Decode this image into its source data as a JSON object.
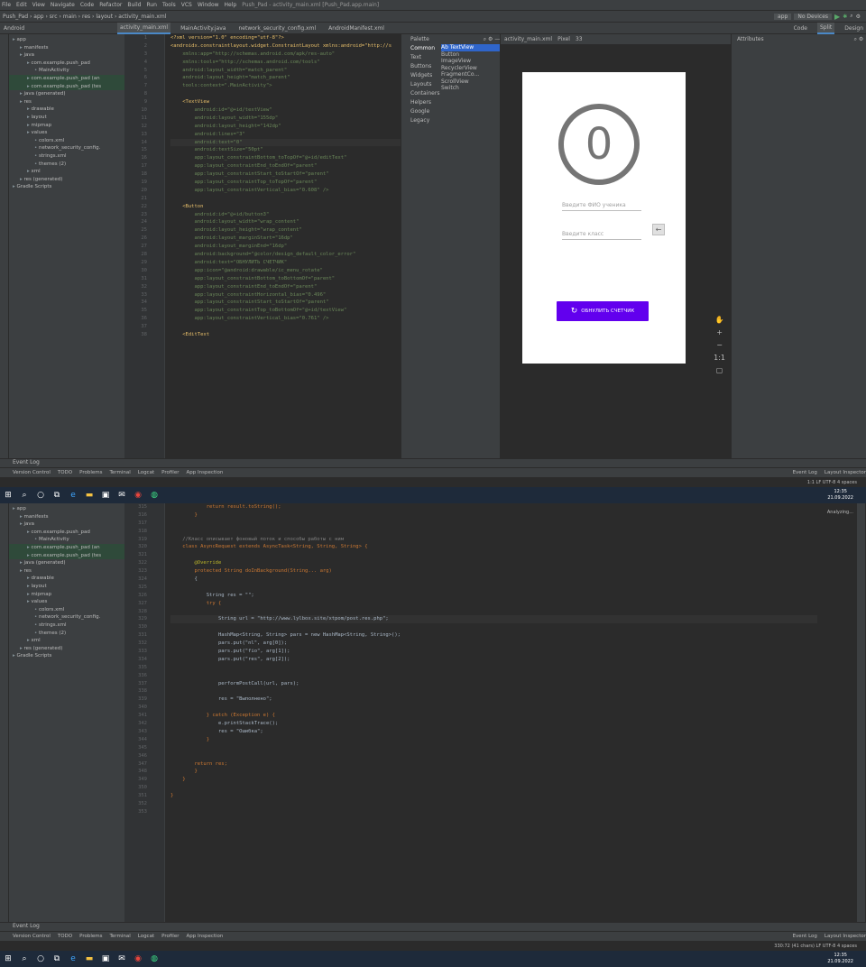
{
  "ide": {
    "menu": [
      "File",
      "Edit",
      "View",
      "Navigate",
      "Code",
      "Refactor",
      "Build",
      "Run",
      "Tools",
      "VCS",
      "Window",
      "Help"
    ],
    "window_title": "Push_Pad - activity_main.xml [Push_Pad.app.main]",
    "breadcrumb": [
      "Push_Pad",
      "app",
      "src",
      "main",
      "res",
      "layout",
      "activity_main.xml"
    ],
    "run_config": "app",
    "device_selector": "No Devices",
    "editor_tabs": [
      "activity_main.xml",
      "MainActivity.java",
      "network_security_config.xml",
      "AndroidManifest.xml"
    ],
    "view_modes": [
      "Code",
      "Split",
      "Design"
    ],
    "android_view_label": "Android"
  },
  "project_tree": [
    {
      "label": "app",
      "indent": 0
    },
    {
      "label": "manifests",
      "indent": 1
    },
    {
      "label": "java",
      "indent": 1
    },
    {
      "label": "com.example.push_pad",
      "indent": 2
    },
    {
      "label": "MainActivity",
      "indent": 3
    },
    {
      "label": "com.example.push_pad (an",
      "indent": 2
    },
    {
      "label": "com.example.push_pad (tes",
      "indent": 2
    },
    {
      "label": "java (generated)",
      "indent": 1
    },
    {
      "label": "res",
      "indent": 1
    },
    {
      "label": "drawable",
      "indent": 2
    },
    {
      "label": "layout",
      "indent": 2
    },
    {
      "label": "mipmap",
      "indent": 2
    },
    {
      "label": "values",
      "indent": 2
    },
    {
      "label": "colors.xml",
      "indent": 3
    },
    {
      "label": "network_security_config.",
      "indent": 3
    },
    {
      "label": "strings.xml",
      "indent": 3
    },
    {
      "label": "themes (2)",
      "indent": 3
    },
    {
      "label": "xml",
      "indent": 2
    },
    {
      "label": "res (generated)",
      "indent": 1
    },
    {
      "label": "Gradle Scripts",
      "indent": 0
    }
  ],
  "xml_editor": {
    "line_numbers": [
      "1",
      "2",
      "3",
      "4",
      "5",
      "6",
      "7",
      "8",
      "9",
      "10",
      "11",
      "12",
      "13",
      "14",
      "15",
      "16",
      "17",
      "18",
      "19",
      "20",
      "21",
      "22",
      "23",
      "24",
      "25",
      "26",
      "27",
      "28",
      "29",
      "30",
      "31",
      "32",
      "33",
      "34",
      "35",
      "36",
      "37",
      "38"
    ],
    "lines": [
      "<?xml version=\"1.0\" encoding=\"utf-8\"?>",
      "<androidx.constraintlayout.widget.ConstraintLayout xmlns:android=\"http://s",
      "    xmlns:app=\"http://schemas.android.com/apk/res-auto\"",
      "    xmlns:tools=\"http://schemas.android.com/tools\"",
      "    android:layout_width=\"match_parent\"",
      "    android:layout_height=\"match_parent\"",
      "    tools:context=\".MainActivity\">",
      "",
      "    <TextView",
      "        android:id=\"@+id/textView\"",
      "        android:layout_width=\"155dp\"",
      "        android:layout_height=\"142dp\"",
      "        android:lines=\"3\"",
      "        android:text=\"0\"",
      "        android:textSize=\"50pt\"",
      "        app:layout_constraintBottom_toTopOf=\"@+id/editText\"",
      "        app:layout_constraintEnd_toEndOf=\"parent\"",
      "        app:layout_constraintStart_toStartOf=\"parent\"",
      "        app:layout_constraintTop_toTopOf=\"parent\"",
      "        app:layout_constraintVertical_bias=\"0.608\" />",
      "",
      "    <Button",
      "        android:id=\"@+id/button3\"",
      "        android:layout_width=\"wrap_content\"",
      "        android:layout_height=\"wrap_content\"",
      "        android:layout_marginStart=\"16dp\"",
      "        android:layout_marginEnd=\"16dp\"",
      "        android:background=\"@color/design_default_color_error\"",
      "        android:text=\"ОБНУЛИТЬ СЧЕТЧИК\"",
      "        app:icon=\"@android:drawable/ic_menu_rotate\"",
      "        app:layout_constraintBottom_toBottomOf=\"parent\"",
      "        app:layout_constraintEnd_toEndOf=\"parent\"",
      "        app:layout_constraintHorizontal_bias=\"0.496\"",
      "        app:layout_constraintStart_toStartOf=\"parent\"",
      "        app:layout_constraintTop_toBottomOf=\"@+id/textView\"",
      "        app:layout_constraintVertical_bias=\"0.761\" />",
      "",
      "    <EditText"
    ]
  },
  "palette": {
    "title": "Palette",
    "categories": [
      "Common",
      "Text",
      "Buttons",
      "Widgets",
      "Layouts",
      "Containers",
      "Helpers",
      "Google",
      "Legacy"
    ],
    "items": [
      "Ab TextView",
      "Button",
      "ImageView",
      "RecyclerView",
      "FragmentCo...",
      "ScrollView",
      "Switch"
    ]
  },
  "design_toolbar": {
    "file": "activity_main.xml",
    "device": "Pixel",
    "api": "33"
  },
  "attributes_title": "Attributes",
  "phone_preview": {
    "counter_text": "0",
    "fio_hint": "Введите ФИО ученика",
    "class_hint": "Введите класс",
    "reset_label": "ОБНУЛИТЬ СЧЕТЧИК"
  },
  "side_tabs_right": [
    "Gradle",
    "Layout Validation",
    "Device Manager",
    "Emulator",
    "Device File Explorer"
  ],
  "side_tabs_left": [
    "Project",
    "Resource Manager",
    "Structure",
    "Favorites",
    "Build Variants"
  ],
  "bottom": {
    "event_log_title": "Event Log",
    "tools": [
      "Version Control",
      "TODO",
      "Problems",
      "Terminal",
      "Logcat",
      "Profiler",
      "App Inspection"
    ],
    "right_tools": [
      "Event Log",
      "Layout Inspector"
    ],
    "status_right_1": "1:1  LF  UTF-8  4 spaces",
    "status_right_2": "330:72 (41 chars)  LF  UTF-8  4 spaces",
    "analyzing": "Analyzing..."
  },
  "java_editor": {
    "line_numbers": [
      "315",
      "316",
      "317",
      "318",
      "319",
      "320",
      "321",
      "322",
      "323",
      "324",
      "325",
      "326",
      "327",
      "328",
      "329",
      "330",
      "331",
      "332",
      "333",
      "334",
      "335",
      "336",
      "337",
      "338",
      "339",
      "340",
      "341",
      "342",
      "343",
      "344",
      "345",
      "346",
      "347",
      "348",
      "349",
      "350",
      "351",
      "352",
      "353"
    ],
    "lines": [
      "            return result.toString();",
      "        }",
      "",
      "",
      "    //Класс описывает фоновый поток и способы работы с ним",
      "    class AsyncRequest extends AsyncTask<String, String, String> {",
      "",
      "        @Override",
      "        protected String doInBackground(String... arg)",
      "        {",
      "",
      "            String res = \"\";",
      "            try {",
      "",
      "                String url = \"http://www.lylbox.site/xtpom/post.res.php\";",
      "",
      "                HashMap<String, String> pars = new HashMap<String, String>();",
      "                pars.put(\"nl\", arg[0]);",
      "                pars.put(\"fio\", arg[1]);",
      "                pars.put(\"res\", arg[2]);",
      "",
      "",
      "                performPostCall(url, pars);",
      "",
      "                res = \"Выполнено\";",
      "",
      "            } catch (Exception e) {",
      "                e.printStackTrace();",
      "                res = \"Ошибка\";",
      "            }",
      "",
      "",
      "        return res;",
      "        }",
      "    }",
      "",
      "}",
      "",
      ""
    ]
  },
  "taskbar": {
    "time": "12:35",
    "date": "21.09.2022",
    "lang": "ENG"
  },
  "colors": {
    "accent": "#4a88c7",
    "purple_button": "#6200ee",
    "panel": "#3c3f41",
    "editor": "#2b2b2b"
  }
}
